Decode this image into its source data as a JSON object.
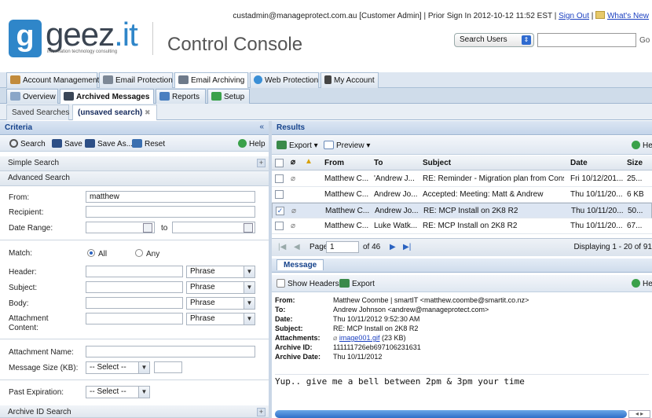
{
  "header": {
    "user_email": "custadmin@manageprotect.com.au",
    "user_role": "[Customer Admin]",
    "prior_signin": "| Prior Sign In 2012-10-12 11:52 EST |",
    "signout_label": "Sign Out",
    "whats_new_label": "What's New",
    "logo_text": "geez",
    "logo_text_tld": ".it",
    "logo_letter": "g",
    "logo_sub": "information technology consulting",
    "console_title": "Control Console",
    "search_select": "Search Users",
    "search_value": "",
    "go_label": "Go"
  },
  "main_tabs": [
    "Account Management",
    "Email Protection",
    "Email Archiving",
    "Web Protection",
    "My Account"
  ],
  "sub_tabs": [
    "Overview",
    "Archived Messages",
    "Reports",
    "Setup"
  ],
  "search_tabs": [
    "Saved Searches",
    "(unsaved search)"
  ],
  "criteria": {
    "title": "Criteria",
    "collapse": "«",
    "toolbar": {
      "search": "Search",
      "save": "Save",
      "save_as": "Save As...",
      "reset": "Reset",
      "help": "Help"
    },
    "simple_search": "Simple Search",
    "advanced_search": "Advanced Search",
    "from_label": "From:",
    "from_value": "matthew",
    "recipient_label": "Recipient:",
    "date_range_label": "Date Range:",
    "date_to": "to",
    "match_label": "Match:",
    "match_all": "All",
    "match_any": "Any",
    "header_label": "Header:",
    "subject_label": "Subject:",
    "body_label": "Body:",
    "attachment_content_label": "Attachment Content:",
    "phrase": "Phrase",
    "attachment_name_label": "Attachment Name:",
    "message_size_label": "Message Size (KB):",
    "select_placeholder": "-- Select --",
    "past_expiration_label": "Past Expiration:",
    "archive_id_search": "Archive ID Search",
    "plus": "+"
  },
  "results": {
    "title": "Results",
    "export_label": "Export",
    "preview_label": "Preview",
    "help_label": "He",
    "columns": [
      "From",
      "To",
      "Subject",
      "Date",
      "Size"
    ],
    "rows": [
      {
        "from": "Matthew C...",
        "to": "'Andrew J...",
        "subject": "RE: Reminder - Migration plan from Cons...",
        "date": "Fri 10/12/201...",
        "size": "25...",
        "attach": true,
        "checked": false,
        "selected": false
      },
      {
        "from": "Matthew C...",
        "to": "Andrew Jo...",
        "subject": "Accepted: Meeting: Matt & Andrew",
        "date": "Thu 10/11/20...",
        "size": "6 KB",
        "attach": false,
        "checked": false,
        "selected": false
      },
      {
        "from": "Matthew C...",
        "to": "Andrew Jo...",
        "subject": "RE: MCP Install on 2K8 R2",
        "date": "Thu 10/11/20...",
        "size": "50...",
        "attach": true,
        "checked": true,
        "selected": true
      },
      {
        "from": "Matthew C...",
        "to": "Luke Watk...",
        "subject": "RE: MCP Install on 2K8 R2",
        "date": "Thu 10/11/20...",
        "size": "67...",
        "attach": true,
        "checked": false,
        "selected": false
      }
    ],
    "pager": {
      "page_label": "Page",
      "page_value": "1",
      "of_label": "of 46",
      "displaying": "Displaying 1 - 20 of 91"
    }
  },
  "message": {
    "tab": "Message",
    "show_headers": "Show Headers",
    "export": "Export",
    "help": "He",
    "from_label": "From:",
    "from_value": "Matthew Coombe | smartIT <matthew.coombe@smartit.co.nz>",
    "to_label": "To:",
    "to_value": "Andrew Johnson <andrew@manageprotect.com>",
    "date_label": "Date:",
    "date_value": "Thu 10/11/2012 9:52:30 AM",
    "subject_label": "Subject:",
    "subject_value": "RE: MCP Install on 2K8 R2",
    "attachments_label": "Attachments:",
    "attachment_link": "image001.gif",
    "attachment_size": "(23 KB)",
    "archive_id_label": "Archive ID:",
    "archive_id_value": "111111726eb697106231631",
    "archive_date_label": "Archive Date:",
    "archive_date_value": "Thu 10/11/2012",
    "body": "Yup.. give me a bell between 2pm & 3pm your time"
  },
  "colors": {
    "brand_blue": "#2f86c9",
    "link": "#1a3fc0",
    "panel_title": "#15428b"
  }
}
